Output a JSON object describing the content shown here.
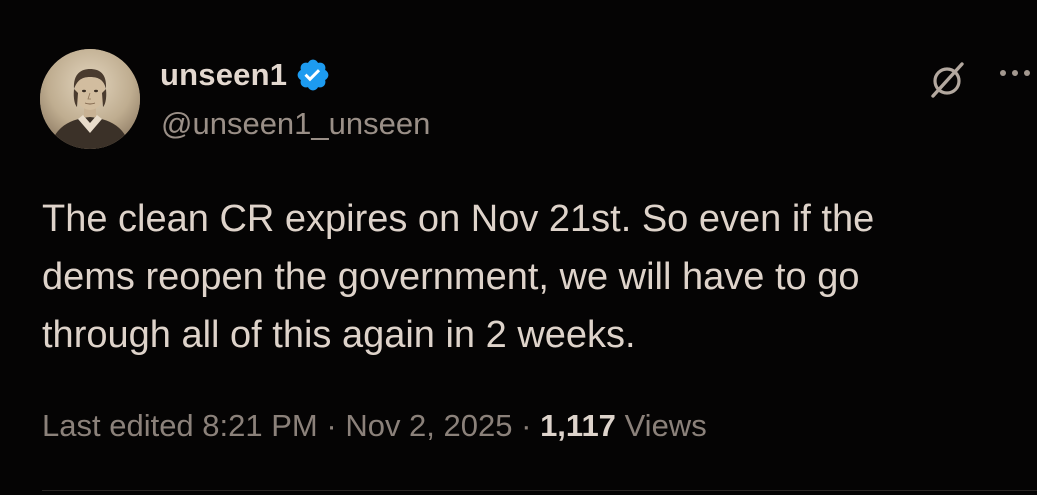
{
  "author": {
    "display_name": "unseen1",
    "handle": "@unseen1_unseen",
    "verified": true
  },
  "tweet": {
    "text": "The clean CR expires on Nov 21st.  So even if the\ndems reopen the government, we will have to go\nthrough all of this again in 2 weeks."
  },
  "meta": {
    "edited_label": "Last edited 8:21 PM",
    "separator": "·",
    "date": "Nov 2, 2025",
    "views_count": "1,117",
    "views_label": "Views"
  },
  "icons": {
    "verified": "verified-badge-icon",
    "grok": "grok-icon",
    "more": "more-options-icon"
  },
  "colors": {
    "background": "#050404",
    "verified_blue": "#1d9bf0",
    "text": "#ded3ca",
    "secondary": "#8b817a"
  }
}
